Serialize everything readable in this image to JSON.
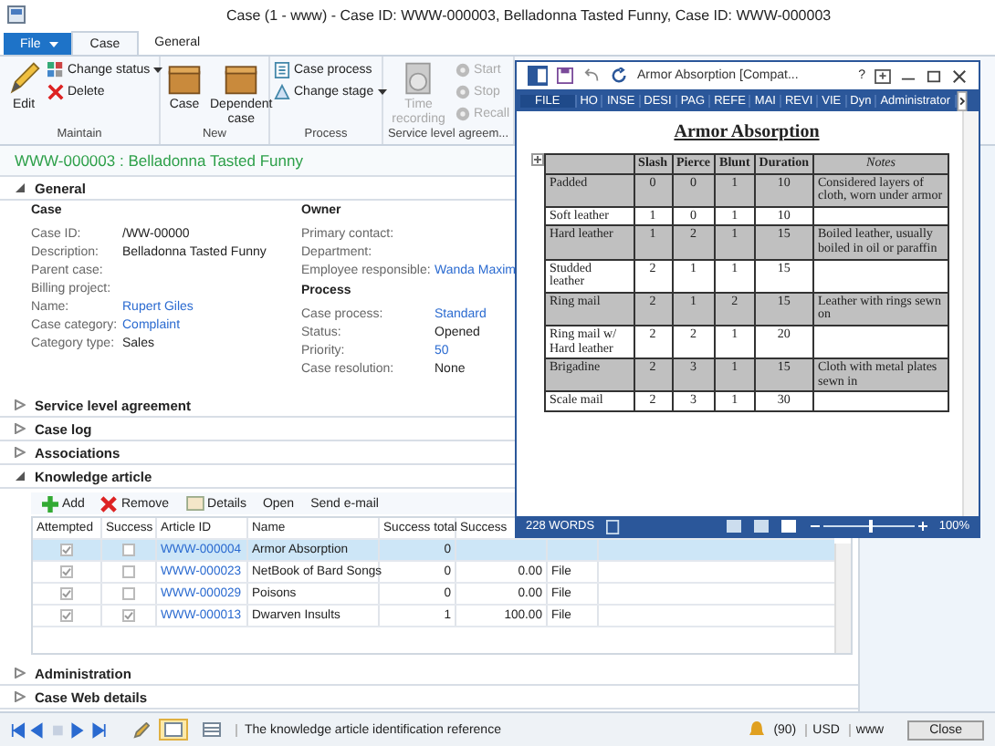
{
  "window": {
    "title": "Case (1 - www) - Case ID: WWW-000003, Belladonna Tasted Funny, Case ID: WWW-000003"
  },
  "tabs": [
    {
      "label": "File",
      "kind": "file",
      "selected": false
    },
    {
      "label": "Case",
      "kind": "tab",
      "selected": true
    },
    {
      "label": "General",
      "kind": "tab",
      "selected": false
    }
  ],
  "ribbon": {
    "groups": [
      {
        "label": "Maintain",
        "buttons": [
          {
            "label": "Edit",
            "kind": "large",
            "disabled": false
          },
          {
            "label": "Change status",
            "kind": "small",
            "disabled": false,
            "dropdown": true
          },
          {
            "label": "Delete",
            "kind": "small",
            "disabled": false,
            "dropdown": false
          }
        ]
      },
      {
        "label": "New",
        "buttons": [
          {
            "label": "Case",
            "kind": "large",
            "disabled": false
          },
          {
            "label": "Dependent case",
            "kind": "large",
            "disabled": false
          }
        ]
      },
      {
        "label": "Process",
        "buttons": [
          {
            "label": "Case process",
            "kind": "small",
            "disabled": false,
            "dropdown": false
          },
          {
            "label": "Change stage",
            "kind": "small",
            "disabled": false,
            "dropdown": true
          }
        ]
      },
      {
        "label": "Service level agreem...",
        "buttons": [
          {
            "label": "Time recording",
            "kind": "large",
            "disabled": true
          },
          {
            "label": "Start",
            "kind": "small",
            "disabled": true,
            "dropdown": false
          },
          {
            "label": "Stop",
            "kind": "small",
            "disabled": true,
            "dropdown": false
          },
          {
            "label": "Recall",
            "kind": "small",
            "disabled": true,
            "dropdown": false
          }
        ]
      }
    ]
  },
  "record_header": "WWW-000003 : Belladonna Tasted Funny",
  "sections": [
    {
      "kind": "general",
      "title": "General",
      "expanded": true
    },
    {
      "title": "Service level agreement",
      "expanded": false
    },
    {
      "title": "Case log",
      "expanded": false
    },
    {
      "title": "Associations",
      "expanded": false
    },
    {
      "kind": "knowledge",
      "title": "Knowledge article",
      "expanded": true
    },
    {
      "title": "Administration",
      "expanded": false
    },
    {
      "title": "Case Web details",
      "expanded": false
    }
  ],
  "general": {
    "case": {
      "heading": "Case",
      "fields": [
        {
          "label": "Case ID:",
          "value": "/WW-00000",
          "link": false
        },
        {
          "label": "Description:",
          "value": "Belladonna Tasted Funny",
          "link": false
        },
        {
          "label": "Parent case:"
        },
        {
          "label": "Billing project:"
        },
        {
          "label": "Name:",
          "value": "Rupert Giles",
          "link": true
        },
        {
          "label": "Case category:",
          "value": "Complaint",
          "link": true
        },
        {
          "label": "Category type:",
          "value": "Sales",
          "link": false
        }
      ]
    },
    "owner": {
      "heading": "Owner",
      "fields": [
        {
          "label": "Primary contact:"
        },
        {
          "label": "Department:"
        },
        {
          "label": "Employee responsible:",
          "value": "Wanda Maxim",
          "link": true
        }
      ]
    },
    "process": {
      "heading": "Process",
      "fields": [
        {
          "label": "Case process:",
          "value": "Standard",
          "link": true
        },
        {
          "label": "Status:",
          "value": "Opened",
          "link": false
        },
        {
          "label": "Priority:",
          "value": "50",
          "link": true
        },
        {
          "label": "Case resolution:",
          "value": "None",
          "link": false
        }
      ]
    }
  },
  "knowledge_article": {
    "toolbar": [
      {
        "label": "Add",
        "kind": "add"
      },
      {
        "label": "Remove",
        "kind": "remove"
      },
      {
        "label": "Details",
        "kind": "details"
      },
      {
        "label": "Open",
        "kind": "text"
      },
      {
        "label": "Send e-mail",
        "kind": "text"
      }
    ],
    "columns": [
      "Attempted",
      "Success",
      "Article ID",
      "Name",
      "Success total",
      "Success"
    ],
    "rows": [
      {
        "attempted": true,
        "success": false,
        "article_id": "WWW-000004",
        "name": "Armor Absorption",
        "success_total": "0",
        "selected": true
      },
      {
        "attempted": true,
        "success": false,
        "article_id": "WWW-000023",
        "name": "NetBook of Bard Songs",
        "success_total": "0",
        "success_pct": "0.00",
        "type": "File",
        "selected": false
      },
      {
        "attempted": true,
        "success": false,
        "article_id": "WWW-000029",
        "name": "Poisons",
        "success_total": "0",
        "success_pct": "0.00",
        "type": "File",
        "selected": false
      },
      {
        "attempted": true,
        "success": true,
        "article_id": "WWW-000013",
        "name": "Dwarven Insults",
        "success_total": "1",
        "success_pct": "100.00",
        "type": "File",
        "selected": false
      }
    ]
  },
  "status_bar": {
    "message": "The knowledge article identification reference",
    "alerts": "(90)",
    "currency": "USD",
    "company": "www",
    "close": "Close"
  },
  "word": {
    "title": "Armor Absorption [Compat...",
    "help": "?",
    "tabs": [
      {
        "label": "FILE",
        "selected": true
      },
      {
        "label": "HO",
        "selected": false
      },
      {
        "label": "INSE",
        "selected": false
      },
      {
        "label": "DESI",
        "selected": false
      },
      {
        "label": "PAG",
        "selected": false
      },
      {
        "label": "REFE",
        "selected": false
      },
      {
        "label": "MAI",
        "selected": false
      },
      {
        "label": "REVI",
        "selected": false
      },
      {
        "label": "VIE",
        "selected": false
      },
      {
        "label": "Dyn",
        "selected": false
      },
      {
        "label": "Administrator",
        "selected": false
      }
    ],
    "doc_title": "Armor Absorption",
    "columns": [
      "",
      "Slash",
      "Pierce",
      "Blunt",
      "Duration",
      "Notes"
    ],
    "rows": [
      {
        "cells": [
          "Padded",
          "0",
          "0",
          "1",
          "10",
          "Considered layers of cloth, worn under armor"
        ],
        "shaded": true
      },
      {
        "cells": [
          "Soft leather",
          "1",
          "0",
          "1",
          "10",
          ""
        ],
        "shaded": false
      },
      {
        "cells": [
          "Hard leather",
          "1",
          "2",
          "1",
          "15",
          "Boiled leather, usually boiled in oil or paraffin"
        ],
        "shaded": true
      },
      {
        "cells": [
          "Studded leather",
          "2",
          "1",
          "1",
          "15",
          ""
        ],
        "shaded": false
      },
      {
        "cells": [
          "Ring mail",
          "2",
          "1",
          "2",
          "15",
          "Leather with rings sewn on"
        ],
        "shaded": true
      },
      {
        "cells": [
          "Ring mail w/ Hard leather",
          "2",
          "2",
          "1",
          "20",
          ""
        ],
        "shaded": false
      },
      {
        "cells": [
          "Brigadine",
          "2",
          "3",
          "1",
          "15",
          "Cloth with metal plates sewn in"
        ],
        "shaded": true
      },
      {
        "cells": [
          "Scale mail",
          "2",
          "3",
          "1",
          "30",
          ""
        ],
        "shaded": false
      }
    ],
    "word_count": "228 WORDS",
    "zoom": {
      "level": 0.5,
      "reading": "100%"
    }
  }
}
